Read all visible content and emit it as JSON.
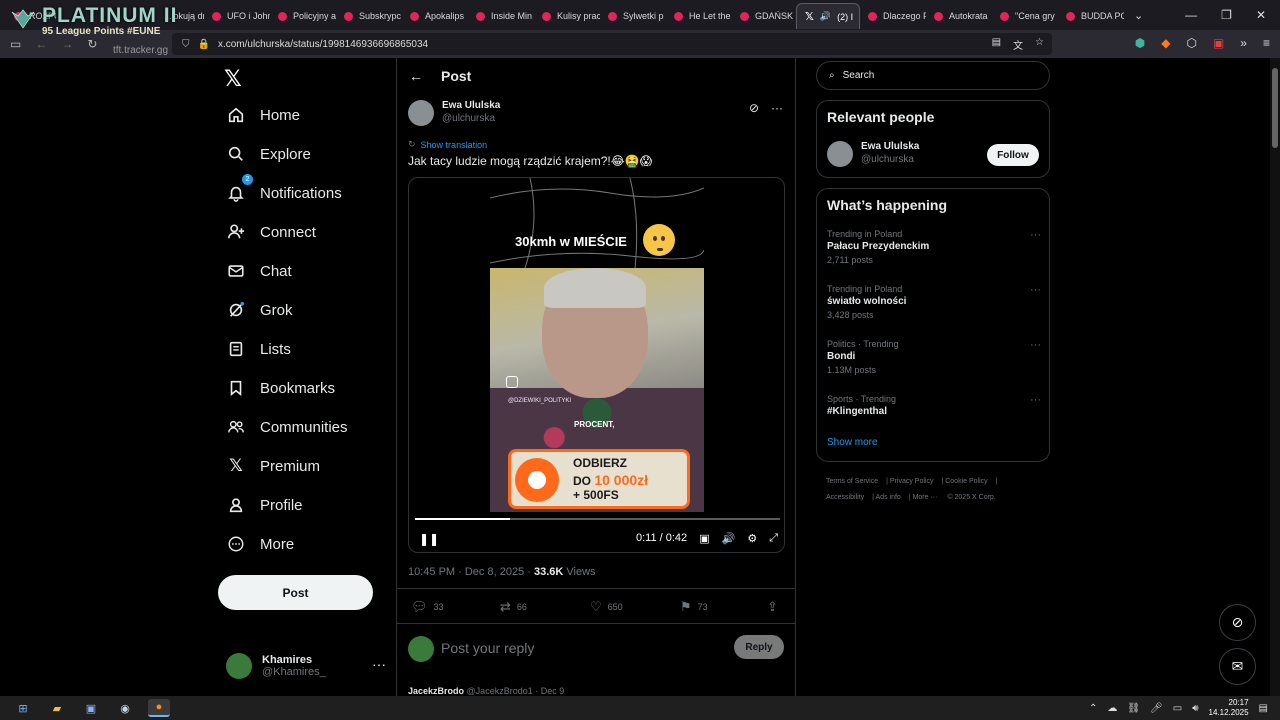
{
  "browser": {
    "tabs": [
      {
        "label": "ROZPOC"
      },
      {
        "label": "...lokują dr"
      },
      {
        "label": "UFO i John"
      },
      {
        "label": "Policyjny a"
      },
      {
        "label": "Subskrypc"
      },
      {
        "label": "Apokalips"
      },
      {
        "label": "Inside Min"
      },
      {
        "label": "Kulisy prac"
      },
      {
        "label": "Sylwetki p"
      },
      {
        "label": "He Let the"
      },
      {
        "label": "GDAŃSK 2"
      },
      {
        "label": "(2) I"
      },
      {
        "label": "Dlaczego F"
      },
      {
        "label": "Autokrata"
      },
      {
        "label": "\"Cena gry"
      },
      {
        "label": "BUDDA PC"
      }
    ],
    "url": "x.com/ulchurska/status/1998146936696865034"
  },
  "overlay": {
    "title": "PLATINUM II",
    "subtitle": "95 League Points #EUNE",
    "source": "tft.tracker.gg"
  },
  "nav": {
    "items": [
      {
        "label": "Home",
        "icon": "home-icon"
      },
      {
        "label": "Explore",
        "icon": "search-icon"
      },
      {
        "label": "Notifications",
        "icon": "bell-icon",
        "badge": "2"
      },
      {
        "label": "Connect",
        "icon": "person-add-icon"
      },
      {
        "label": "Chat",
        "icon": "mail-icon"
      },
      {
        "label": "Grok",
        "icon": "grok-icon"
      },
      {
        "label": "Lists",
        "icon": "lists-icon"
      },
      {
        "label": "Bookmarks",
        "icon": "bookmark-icon"
      },
      {
        "label": "Communities",
        "icon": "communities-icon"
      },
      {
        "label": "Premium",
        "icon": "x-icon"
      },
      {
        "label": "Profile",
        "icon": "profile-icon"
      },
      {
        "label": "More",
        "icon": "more-icon"
      }
    ],
    "post_label": "Post",
    "account": {
      "name": "Khamires",
      "handle": "@Khamires_"
    }
  },
  "post": {
    "header_title": "Post",
    "author_name": "Ewa Ululska",
    "author_handle": "@ulchurska",
    "show_translation": "Show translation",
    "text": "Jak tacy ludzie mogą rządzić krajem?!😂🤮😱",
    "video": {
      "overlay_title": "30kmh w MIEŚCIE",
      "watermark": "@DZIEWIKI_POLITYKI",
      "caption": "PROCENT,",
      "ad_line1": "ODBIERZ",
      "ad_line2_prefix": "DO ",
      "ad_line2_amount": "10 000zł",
      "ad_line3": "+ 500FS",
      "time": "0:11 / 0:42",
      "progress": 0.26
    },
    "timestamp": "10:45 PM · Dec 8, 2025 · ",
    "views_count": "33.6K",
    "views_label": " Views",
    "replies": "33",
    "reposts": "66",
    "likes": "650",
    "bookmarks": "73",
    "reply_placeholder": "Post your reply",
    "reply_button": "Reply",
    "next_reply_name": "JacekzBrodo",
    "next_reply_meta": "@JacekzBrodo1 · Dec 9"
  },
  "sidebar": {
    "search_placeholder": "Search",
    "relevant_title": "Relevant people",
    "relevant_name": "Ewa Ululska",
    "relevant_handle": "@ulchurska",
    "follow_label": "Follow",
    "happening_title": "What’s happening",
    "trends": [
      {
        "context": "Trending in Poland",
        "name": "Pałacu Prezydenckim",
        "count": "2,711 posts"
      },
      {
        "context": "Trending in Poland",
        "name": "światło wolności",
        "count": "3,428 posts"
      },
      {
        "context": "Politics · Trending",
        "name": "Bondi",
        "count": "1.13M posts"
      },
      {
        "context": "Sports · Trending",
        "name": "#Klingenthal",
        "count": ""
      }
    ],
    "show_more": "Show more",
    "footer": [
      "Terms of Service",
      "Privacy Policy",
      "Cookie Policy",
      "Accessibility",
      "Ads info",
      "More ···",
      "© 2025 X Corp."
    ]
  },
  "taskbar": {
    "time": "20:17",
    "date": "14.12.2025"
  },
  "colors": {
    "accent": "#1d9bf0",
    "bg": "#000000",
    "ad_orange": "#ff6a1a"
  }
}
